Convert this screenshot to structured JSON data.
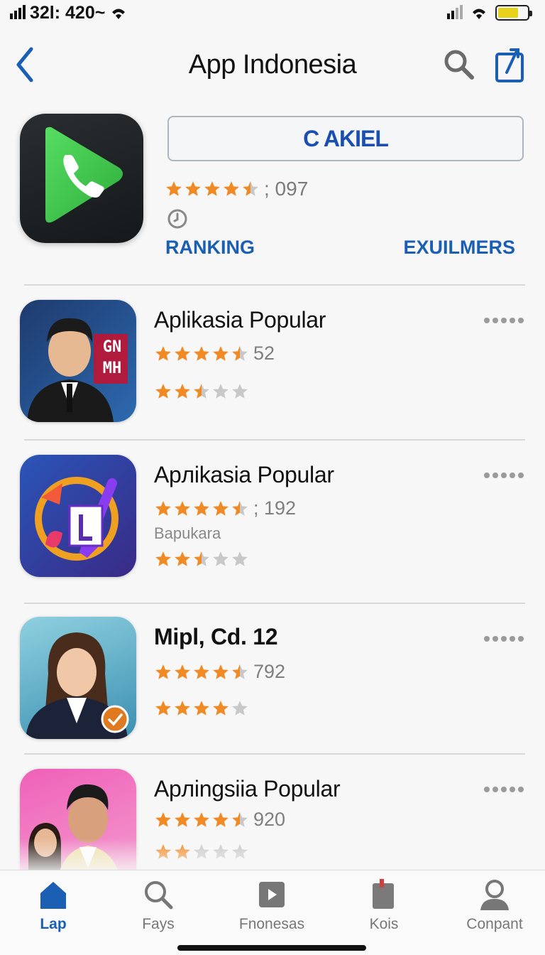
{
  "status_bar": {
    "time": "32l: 420~"
  },
  "nav": {
    "title": "App Indonesia",
    "back_icon": "chevron-left-icon",
    "search_icon": "search-icon",
    "share_icon": "share-icon"
  },
  "featured": {
    "icon": "phone-app-icon",
    "button_label": "C AKIEL",
    "rating_stars": 4.5,
    "rating_count": "; 097",
    "clock_icon": "clock-icon",
    "link_left": "RANKING",
    "link_right": "EXUILMERS"
  },
  "apps": [
    {
      "title": "Aplikasia Popular",
      "stars": 4.5,
      "count": "52",
      "subtitle": "",
      "stars2": 2.5,
      "icon": "portrait-icon",
      "badge_text": "GN MH"
    },
    {
      "title": "Apлikasia Popular",
      "stars": 4.5,
      "count": "; 192",
      "subtitle": "Bapukara",
      "stars2": 2.5,
      "icon": "sync-app-icon",
      "badge_text": ""
    },
    {
      "title": "Mipl, Cd. 12",
      "stars": 4.5,
      "count": "792",
      "subtitle": "",
      "stars2": 4.0,
      "icon": "portrait-icon",
      "badge_text": ""
    },
    {
      "title": "Apлingsiia Popular",
      "stars": 4.5,
      "count": "920",
      "subtitle": "",
      "stars2": 2.0,
      "icon": "portrait-icon",
      "badge_text": ""
    }
  ],
  "tabs": [
    {
      "label": "Lap",
      "icon": "home-icon",
      "active": true
    },
    {
      "label": "Fays",
      "icon": "search-icon",
      "active": false
    },
    {
      "label": "Fnonesas",
      "icon": "play-icon",
      "active": false
    },
    {
      "label": "Kois",
      "icon": "bookmark-icon",
      "active": false
    },
    {
      "label": "Conpant",
      "icon": "person-icon",
      "active": false
    }
  ],
  "colors": {
    "accent": "#1a5fb4",
    "star": "#f08a24",
    "star_empty": "#c8c8c8"
  }
}
